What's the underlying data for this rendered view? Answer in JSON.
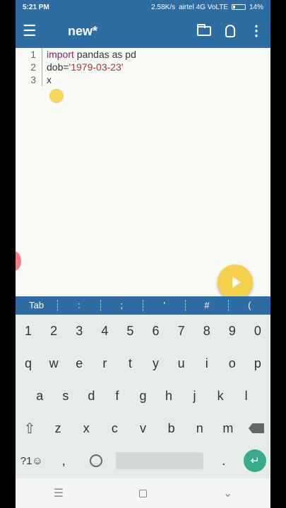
{
  "status": {
    "time": "5:21 PM",
    "speed": "2.58K/s",
    "carrier": "airtel 4G VoLTE",
    "battery": "14%"
  },
  "appbar": {
    "title": "new*"
  },
  "editor": {
    "lines": [
      {
        "num": "1",
        "kw": "import",
        "rest": " pandas as pd"
      },
      {
        "num": "2",
        "pre": "dob=",
        "str": "'1979-03-23'"
      },
      {
        "num": "3",
        "text": "x"
      }
    ]
  },
  "symbols": [
    "Tab",
    ":",
    ";",
    "'",
    "#",
    "("
  ],
  "keyboard": {
    "numbers": [
      "1",
      "2",
      "3",
      "4",
      "5",
      "6",
      "7",
      "8",
      "9",
      "0"
    ],
    "row1": [
      "q",
      "w",
      "e",
      "r",
      "t",
      "y",
      "u",
      "i",
      "o",
      "p"
    ],
    "row2": [
      "a",
      "s",
      "d",
      "f",
      "g",
      "h",
      "j",
      "k",
      "l"
    ],
    "row3": [
      "z",
      "x",
      "c",
      "v",
      "b",
      "n",
      "m"
    ],
    "symbols_key": "?1☺",
    "comma": ",",
    "period": "."
  }
}
